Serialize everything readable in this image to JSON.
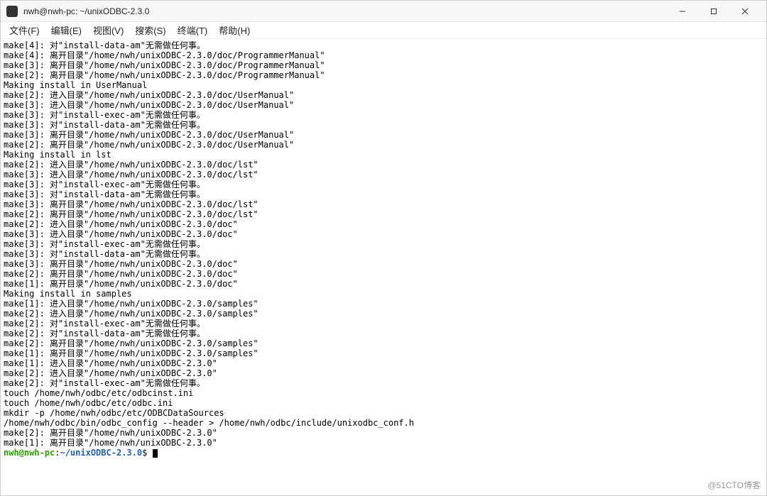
{
  "window": {
    "title": "nwh@nwh-pc: ~/unixODBC-2.3.0",
    "controls": {
      "minimize": "—",
      "maximize": "☐",
      "close": "✕"
    }
  },
  "menubar": {
    "items": [
      "文件(F)",
      "编辑(E)",
      "视图(V)",
      "搜索(S)",
      "终端(T)",
      "帮助(H)"
    ]
  },
  "terminal": {
    "lines": [
      "make[4]: 对\"install-data-am\"无需做任何事。",
      "make[4]: 离开目录\"/home/nwh/unixODBC-2.3.0/doc/ProgrammerManual\"",
      "make[3]: 离开目录\"/home/nwh/unixODBC-2.3.0/doc/ProgrammerManual\"",
      "make[2]: 离开目录\"/home/nwh/unixODBC-2.3.0/doc/ProgrammerManual\"",
      "Making install in UserManual",
      "make[2]: 进入目录\"/home/nwh/unixODBC-2.3.0/doc/UserManual\"",
      "make[3]: 进入目录\"/home/nwh/unixODBC-2.3.0/doc/UserManual\"",
      "make[3]: 对\"install-exec-am\"无需做任何事。",
      "make[3]: 对\"install-data-am\"无需做任何事。",
      "make[3]: 离开目录\"/home/nwh/unixODBC-2.3.0/doc/UserManual\"",
      "make[2]: 离开目录\"/home/nwh/unixODBC-2.3.0/doc/UserManual\"",
      "Making install in lst",
      "make[2]: 进入目录\"/home/nwh/unixODBC-2.3.0/doc/lst\"",
      "make[3]: 进入目录\"/home/nwh/unixODBC-2.3.0/doc/lst\"",
      "make[3]: 对\"install-exec-am\"无需做任何事。",
      "make[3]: 对\"install-data-am\"无需做任何事。",
      "make[3]: 离开目录\"/home/nwh/unixODBC-2.3.0/doc/lst\"",
      "make[2]: 离开目录\"/home/nwh/unixODBC-2.3.0/doc/lst\"",
      "make[2]: 进入目录\"/home/nwh/unixODBC-2.3.0/doc\"",
      "make[3]: 进入目录\"/home/nwh/unixODBC-2.3.0/doc\"",
      "make[3]: 对\"install-exec-am\"无需做任何事。",
      "make[3]: 对\"install-data-am\"无需做任何事。",
      "make[3]: 离开目录\"/home/nwh/unixODBC-2.3.0/doc\"",
      "make[2]: 离开目录\"/home/nwh/unixODBC-2.3.0/doc\"",
      "make[1]: 离开目录\"/home/nwh/unixODBC-2.3.0/doc\"",
      "Making install in samples",
      "make[1]: 进入目录\"/home/nwh/unixODBC-2.3.0/samples\"",
      "make[2]: 进入目录\"/home/nwh/unixODBC-2.3.0/samples\"",
      "make[2]: 对\"install-exec-am\"无需做任何事。",
      "make[2]: 对\"install-data-am\"无需做任何事。",
      "make[2]: 离开目录\"/home/nwh/unixODBC-2.3.0/samples\"",
      "make[1]: 离开目录\"/home/nwh/unixODBC-2.3.0/samples\"",
      "make[1]: 进入目录\"/home/nwh/unixODBC-2.3.0\"",
      "make[2]: 进入目录\"/home/nwh/unixODBC-2.3.0\"",
      "make[2]: 对\"install-exec-am\"无需做任何事。",
      "touch /home/nwh/odbc/etc/odbcinst.ini",
      "touch /home/nwh/odbc/etc/odbc.ini",
      "mkdir -p /home/nwh/odbc/etc/ODBCDataSources",
      "/home/nwh/odbc/bin/odbc_config --header > /home/nwh/odbc/include/unixodbc_conf.h",
      "make[2]: 离开目录\"/home/nwh/unixODBC-2.3.0\"",
      "make[1]: 离开目录\"/home/nwh/unixODBC-2.3.0\""
    ],
    "prompt": {
      "user": "nwh@nwh-pc",
      "sep": ":",
      "path": "~/unixODBC-2.3.0",
      "symbol": "$"
    }
  },
  "watermark": "@51CTO博客"
}
